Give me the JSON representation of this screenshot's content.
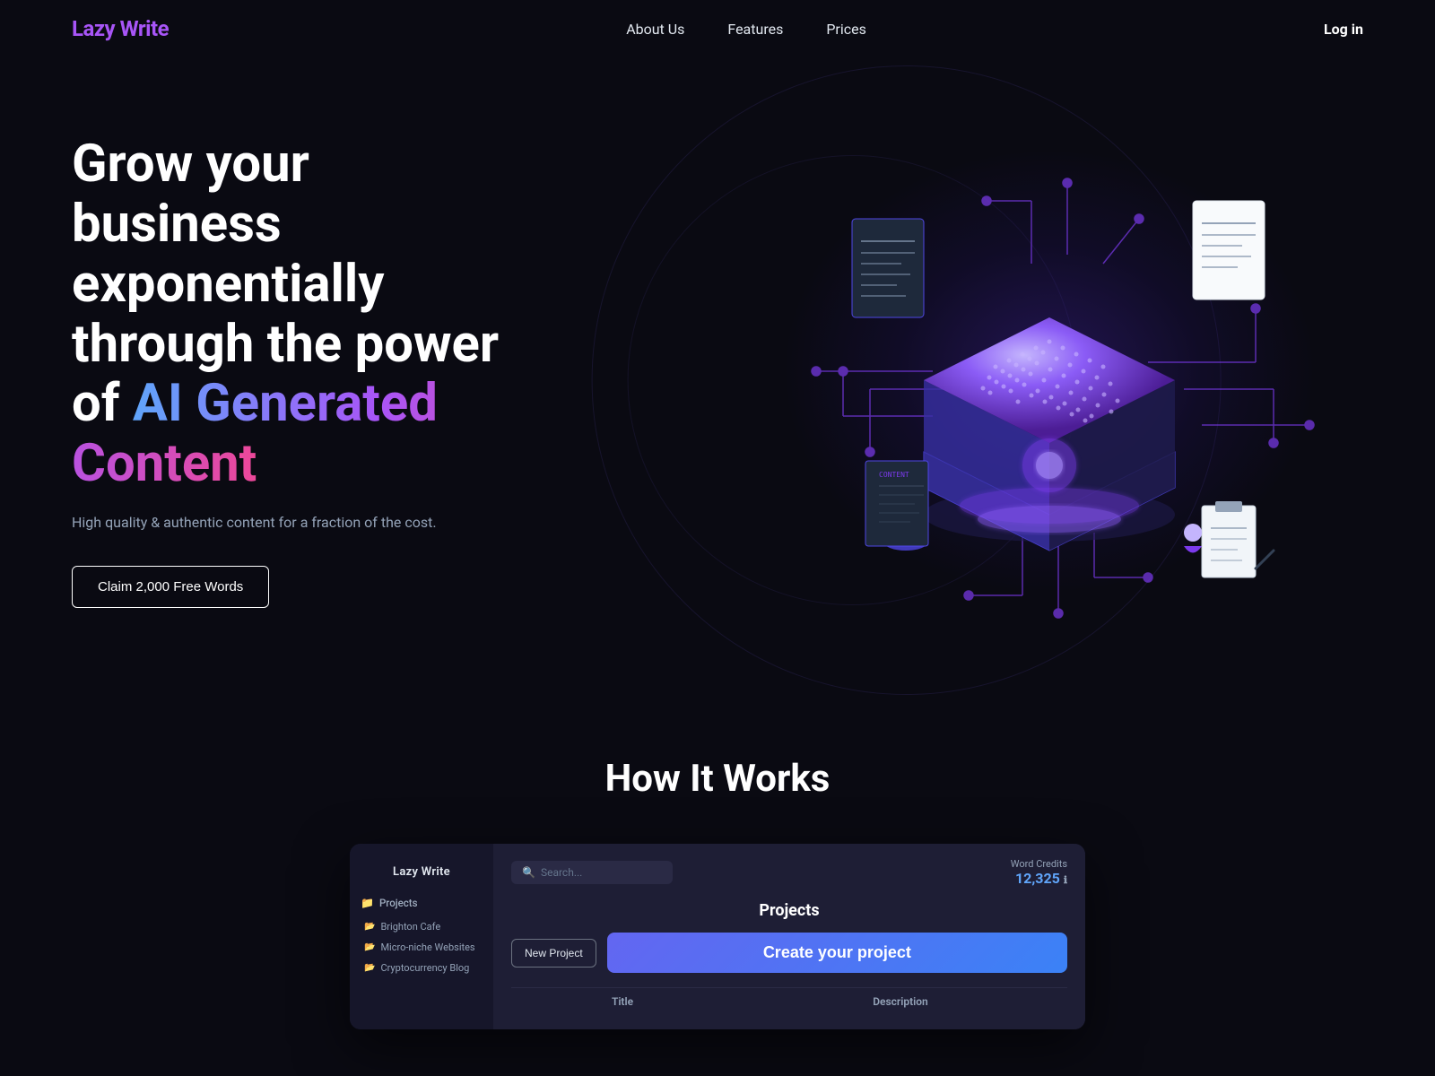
{
  "brand": {
    "name": "Lazy Write"
  },
  "nav": {
    "links": [
      {
        "label": "About Us",
        "id": "about"
      },
      {
        "label": "Features",
        "id": "features"
      },
      {
        "label": "Prices",
        "id": "prices"
      }
    ],
    "login": "Log in"
  },
  "hero": {
    "headline_plain": "Grow your business exponentially through the power of ",
    "headline_gradient": "AI Generated Content",
    "subtext": "High quality & authentic content for a fraction of the cost.",
    "cta": "Claim 2,000 Free Words"
  },
  "how_it_works": {
    "title": "How It Works"
  },
  "app_mockup": {
    "sidebar": {
      "title": "Lazy Write",
      "section_label": "Projects",
      "items": [
        {
          "name": "Brighton Cafe"
        },
        {
          "name": "Micro-niche Websites"
        },
        {
          "name": "Cryptocurrency Blog"
        }
      ]
    },
    "search_placeholder": "Search...",
    "word_credits_label": "Word Credits",
    "word_credits_value": "12,325",
    "projects_title": "Projects",
    "new_project_btn": "New Project",
    "create_project_btn": "Create your project",
    "table": {
      "columns": [
        "Title",
        "Description"
      ]
    }
  }
}
